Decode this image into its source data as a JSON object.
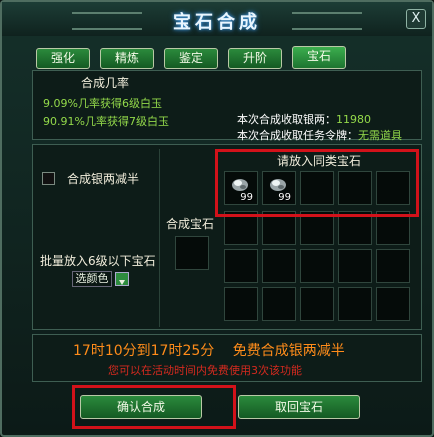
{
  "window": {
    "title": "宝石合成",
    "close": "X"
  },
  "tabs": [
    {
      "label": "强化",
      "active": false
    },
    {
      "label": "精炼",
      "active": false
    },
    {
      "label": "鉴定",
      "active": false
    },
    {
      "label": "升阶",
      "active": false
    },
    {
      "label": "宝石",
      "active": true
    }
  ],
  "info": {
    "rate_title": "合成几率",
    "rate_line1": "9.09%几率获得6级白玉",
    "rate_line2": "90.91%几率获得7级白玉",
    "fee_label": "本次合成收取银两：",
    "fee_value": "11980",
    "token_label": "本次合成收取任务令牌：",
    "token_value": "无需道具"
  },
  "left": {
    "halve_label": "合成银两减半",
    "batch_label": "批量放入6级以下宝石",
    "color_select": "选颜色"
  },
  "center": {
    "result_label": "合成宝石"
  },
  "grid": {
    "title": "请放入同类宝石",
    "slots": [
      {
        "item": "white-jade-gem",
        "qty": "99"
      },
      {
        "item": "white-jade-gem",
        "qty": "99"
      }
    ]
  },
  "notice": {
    "time": "17时10分到17时25分",
    "free": "免费合成银两减半",
    "tip": "您可以在活动时间内免费使用3次该功能"
  },
  "buttons": {
    "confirm": "确认合成",
    "retrieve": "取回宝石"
  },
  "colors": {
    "highlight": "#d2121a",
    "green_text": "#93d94a",
    "notice_orange": "#ff8c1a",
    "notice_red": "#d42a1f"
  }
}
